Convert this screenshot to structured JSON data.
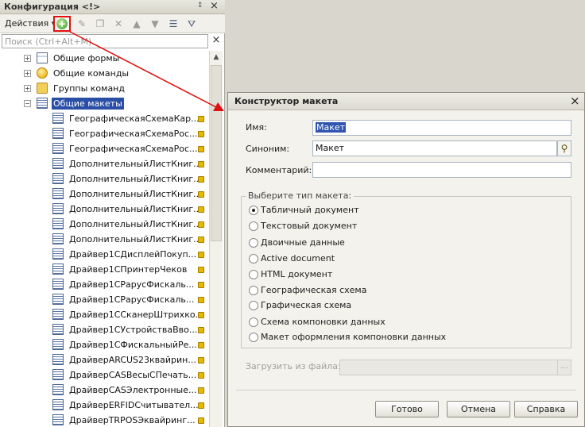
{
  "panel": {
    "title": "Конфигурация <!>",
    "pin_glyph": "↕",
    "close_glyph": "×",
    "actions_label": "Действия ▾",
    "add_glyph": "+",
    "search_placeholder": "Поиск (Ctrl+Alt+M)",
    "search_clear_glyph": "×",
    "toolbar_icons": [
      "edit-icon",
      "copy-icon",
      "delete-icon",
      "move-up-icon",
      "move-down-icon",
      "properties-icon",
      "filter-icon"
    ]
  },
  "tree": {
    "groups": [
      {
        "label": "Общие формы",
        "expand": "+",
        "icon": "form-icon"
      },
      {
        "label": "Общие команды",
        "expand": "+",
        "icon": "command-icon"
      },
      {
        "label": "Группы команд",
        "expand": "+",
        "icon": "folder-icon"
      },
      {
        "label": "Общие макеты",
        "expand": "−",
        "icon": "layout-icon",
        "selected": true
      }
    ],
    "items": [
      "ГеографическаяСхемаКар...",
      "ГеографическаяСхемаРос...",
      "ГеографическаяСхемаРос...",
      "ДополнительныйЛистКниг...",
      "ДополнительныйЛистКниг...",
      "ДополнительныйЛистКниг...",
      "ДополнительныйЛистКниг...",
      "ДополнительныйЛистКниг...",
      "ДополнительныйЛистКниг...",
      "Драйвер1СДисплейПокуп...",
      "Драйвер1СПринтерЧеков",
      "Драйвер1СРарусФискаль...",
      "Драйвер1СРарусФискаль...",
      "Драйвер1ССканерШтрихко...",
      "Драйвер1СУстройстваВво...",
      "Драйвер1СФискальныйРе...",
      "ДрайверARCUS23квайрин...",
      "ДрайверCASВесыСПечать...",
      "ДрайверCASЭлектронные...",
      "ДрайверERFIDСчитывател...",
      "ДрайверTRPOSЭквайринг..."
    ]
  },
  "dialog": {
    "title": "Конструктор макета",
    "close_glyph": "×",
    "name_label": "Имя:",
    "name_value": "Макет",
    "synonym_label": "Синоним:",
    "synonym_value": "Макет",
    "comment_label": "Комментарий:",
    "comment_value": "",
    "group_title": "Выберите тип макета:",
    "types": [
      {
        "label": "Табличный документ",
        "selected": true
      },
      {
        "label": "Текстовый документ",
        "selected": false
      },
      {
        "label": "Двоичные данные",
        "selected": false
      },
      {
        "label": "Active document",
        "selected": false
      },
      {
        "label": "HTML документ",
        "selected": false
      },
      {
        "label": "Географическая схема",
        "selected": false
      },
      {
        "label": "Графическая схема",
        "selected": false
      },
      {
        "label": "Схема компоновки данных",
        "selected": false
      },
      {
        "label": "Макет оформления компоновки данных",
        "selected": false
      }
    ],
    "load_label": "Загрузить из файла:",
    "load_button": "...",
    "ok_button": "Готово",
    "cancel_button": "Отмена",
    "help_button": "Справка"
  },
  "colors": {
    "selection": "#2a4ea6",
    "annotation_red": "#e01010",
    "dialog_bg": "#f3f2ec"
  }
}
